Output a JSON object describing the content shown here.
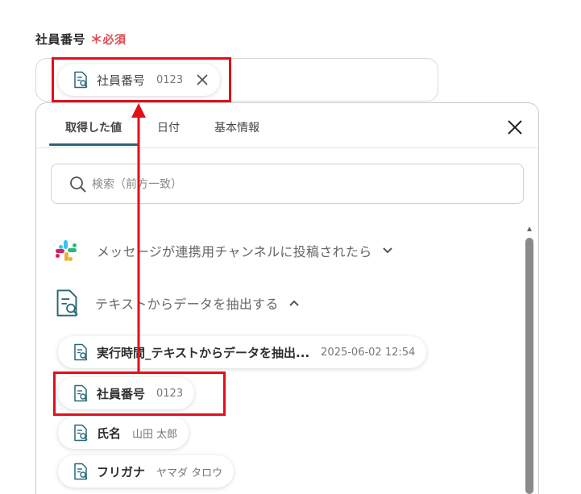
{
  "field": {
    "label": "社員番号",
    "required_mark": "＊",
    "required_text": "必須"
  },
  "selected_chip": {
    "name": "社員番号",
    "value": "0123"
  },
  "tabs": [
    {
      "label": "取得した値",
      "active": true
    },
    {
      "label": "日付",
      "active": false
    },
    {
      "label": "基本情報",
      "active": false
    }
  ],
  "search": {
    "placeholder": "検索（前方一致）",
    "value": ""
  },
  "sections": [
    {
      "label": "メッセージが連携用チャンネルに投稿されたら",
      "icon": "slack-icon",
      "expanded": false
    },
    {
      "label": "テキストからデータを抽出する",
      "icon": "document-search-icon",
      "expanded": true
    }
  ],
  "items": [
    {
      "name": "実行時間_テキストからデータを抽出...",
      "value": "2025-06-02 12:54"
    },
    {
      "name": "社員番号",
      "value": "0123"
    },
    {
      "name": "氏名",
      "value": "山田 太郎"
    },
    {
      "name": "フリガナ",
      "value": "ヤマダ タロウ"
    }
  ],
  "colors": {
    "accent": "#2a6778",
    "required": "#e0474c",
    "highlight": "#e0101a"
  }
}
